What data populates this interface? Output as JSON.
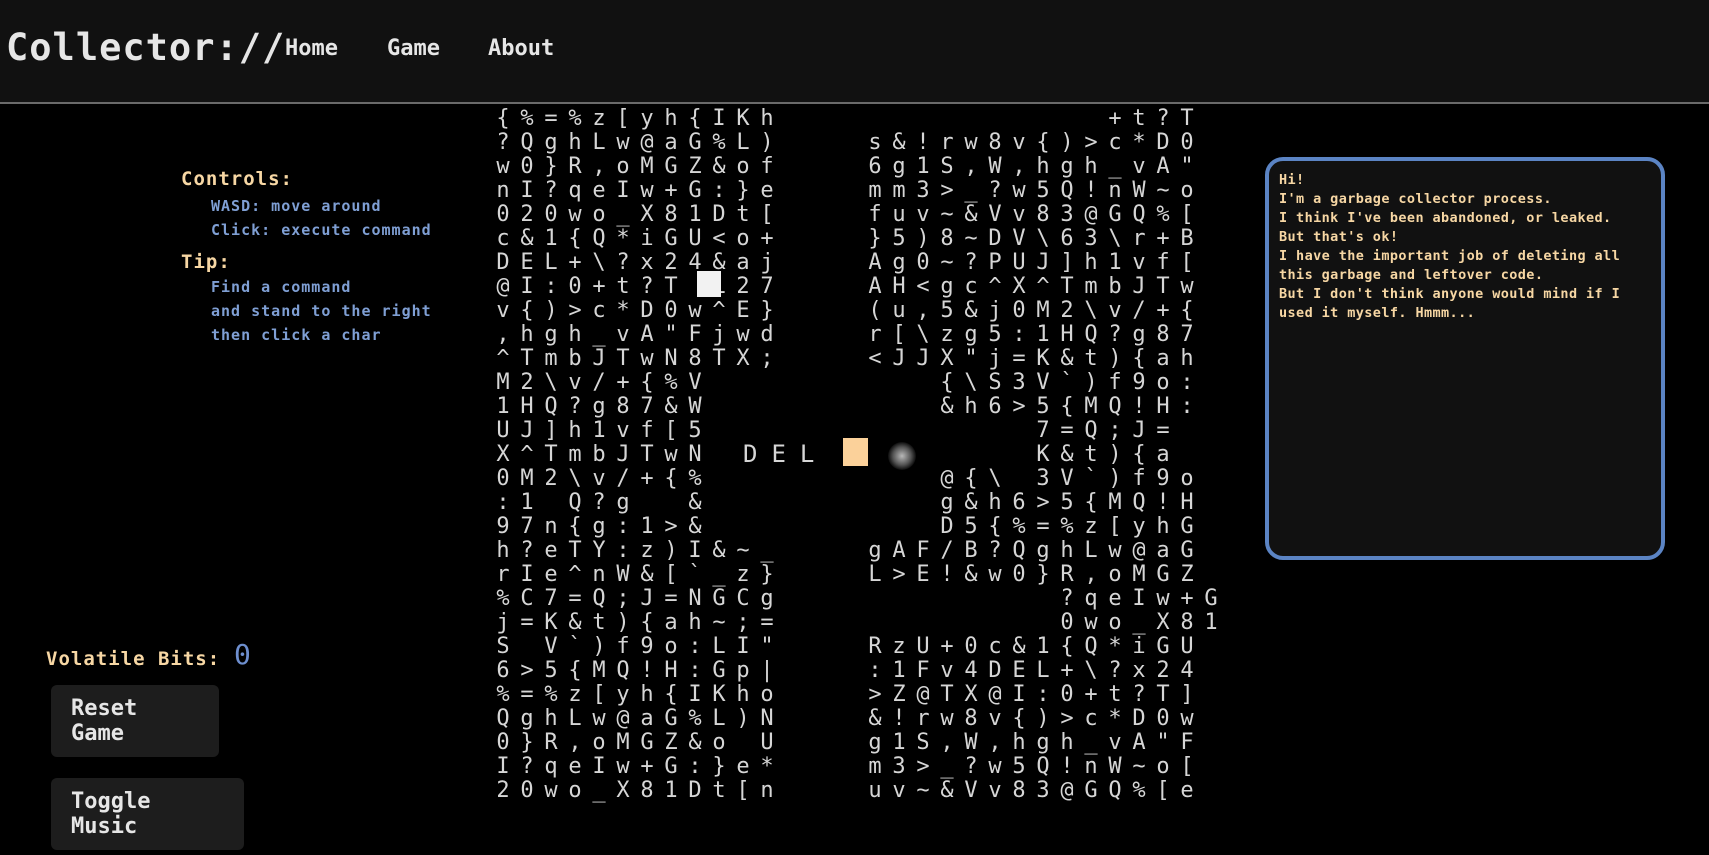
{
  "header": {
    "brand": "Collector://",
    "nav": [
      "Home",
      "Game",
      "About"
    ]
  },
  "controls": {
    "title": "Controls:",
    "lines": [
      "WASD: move around",
      "Click: execute command"
    ],
    "tip_title": "Tip:",
    "tip_lines": [
      "Find a command",
      "and stand to the right",
      "then click a char"
    ]
  },
  "status": {
    "bits_label": "Volatile Bits:",
    "bits_value": "0"
  },
  "buttons": {
    "reset": "Reset Game",
    "music": "Toggle Music"
  },
  "game": {
    "command_word": "DEL",
    "left_rows": [
      "{%=%z[yh{IKh",
      "?QghLw@aG%L)",
      "w0}R,oMGZ&of",
      "nI?qeIw+G:}e",
      "020wo_X81Dt[",
      "c&1{Q*iGU<o+",
      "DEL+\\?x24&aj",
      "@I:0+t?T L27",
      "v{)>c*D0w^E}",
      ",hgh_vA\"Fjwd",
      "^TmbJTwN8TX;",
      "M2\\v/+{%V",
      "1HQ?g87&W",
      "UJ]h1vf[5",
      "X^TmbJTwN",
      "0M2\\v/+{%",
      ":1 Q?g  &",
      "97n{g:1>&",
      "h?eTY:z)I&~_",
      "rIe^nW&[`_z}",
      "%C7=Q;J=NGCg",
      "j=K&t){ah~;=",
      "S V`)f9o:LI\"",
      "6>5{MQ!H:Gp|",
      "%=%z[yh{IKho",
      "QghLw@aG%L)N",
      "0}R,oMGZ&o U",
      "I?qeIw+G:}e*",
      "20wo_X81Dt[n"
    ],
    "right_rows": [
      "          +t?T",
      "s&!rw8v{)>c*D0",
      "6g1S,W,hgh_vA\"",
      "mm3>_?w5Q!nW~o",
      "fuv~&Vv83@GQ%[",
      "}5)8~DV\\63\\r+B",
      "Ag0~?PUJ]h1vf[",
      "AH<gc^X^TmbJTw",
      "(u,5&j0M2\\v/+{",
      "r[\\zg5:1HQ?g87",
      "<JJX\"j=K&t){ah",
      "   {\\S3V`)f9o:",
      "   &h6>5{MQ!H:",
      "       7=Q;J=",
      "       K&t){a",
      "   @{\\ 3V`)f9o",
      "   g&h6>5{MQ!H",
      "   D5{%=%z[yhG",
      "gAF/B?QghLw@aG",
      "L>E!&w0}R,oMGZ",
      "        ?qeIw+G",
      "        0wo_X81",
      "RzU+0c&1{Q*iGU",
      ":1Fv4DEL+\\?x24",
      ">Z@TX@I:0+t?T]",
      "&!rw8v{)>c*D0w",
      "g1S,W,hgh_vA\"F",
      "m3>_?w5Q!nW~o[",
      "uv~&Vv83@GQ%[e"
    ]
  },
  "dialog": {
    "lines": [
      "Hi!",
      "I'm a garbage collector process.",
      "I think I've been abandoned, or leaked.",
      "But that's ok!",
      "I have the important job of deleting all",
      "this garbage and leftover code.",
      "But I don't think anyone would mind if I",
      "used it myself. Hmmm..."
    ]
  },
  "colors": {
    "accent_text": "#f7d7a4",
    "hint_text": "#7f9fd4",
    "dialog_border": "#5b84c4",
    "player": "#fbd19a"
  }
}
